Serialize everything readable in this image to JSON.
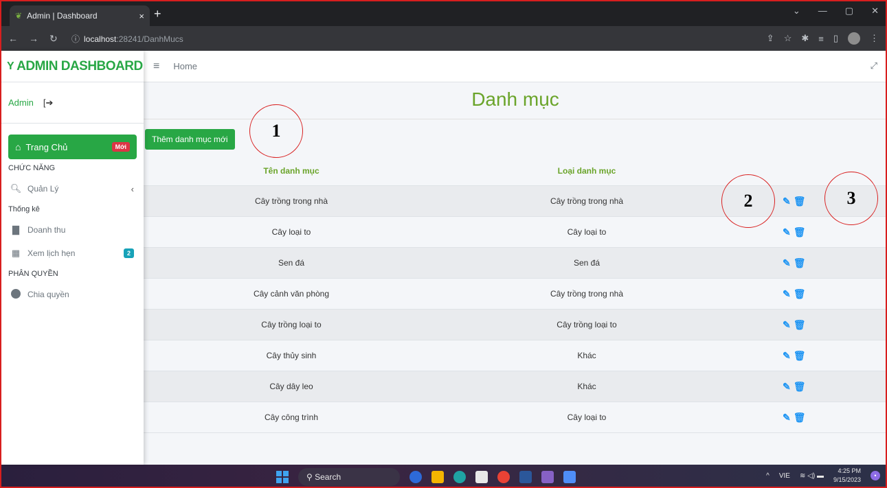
{
  "browser": {
    "tab_title": "Admin | Dashboard",
    "tab_close": "×",
    "new_tab": "+",
    "url_host": "localhost",
    "url_path": ":28241/DanhMucs"
  },
  "sidebar": {
    "brand": "ADMIN DASHBOARD",
    "user_name": "Admin",
    "home": {
      "label": "Trang Chủ",
      "badge": "Mới"
    },
    "sections": [
      {
        "title": "CHỨC NĂNG"
      },
      {
        "title": "Thống kê"
      },
      {
        "title": "PHÂN QUYỀN"
      }
    ],
    "items": [
      {
        "label": "Quản Lý"
      },
      {
        "label": "Doanh thu"
      },
      {
        "label": "Xem lịch hẹn",
        "badge": "2"
      },
      {
        "label": "Chia quyền"
      }
    ]
  },
  "topnav": {
    "breadcrumb": "Home"
  },
  "main": {
    "title": "Danh mục",
    "add_button": "Thêm danh mục mới",
    "columns": [
      "Tên danh mục",
      "Loại danh mục",
      ""
    ],
    "rows": [
      {
        "name": "Cây trồng trong nhà",
        "type": "Cây trồng trong nhà"
      },
      {
        "name": "Cây loại to",
        "type": "Cây loại to"
      },
      {
        "name": "Sen đá",
        "type": "Sen đá"
      },
      {
        "name": "Cây cảnh văn phòng",
        "type": "Cây trồng trong nhà"
      },
      {
        "name": "Cây trồng loại to",
        "type": "Cây trồng loại to"
      },
      {
        "name": "Cây thủy sinh",
        "type": "Khác"
      },
      {
        "name": "Cây dây leo",
        "type": "Khác"
      },
      {
        "name": "Cây công trình",
        "type": "Cây loại to"
      }
    ]
  },
  "annotations": [
    "1",
    "2",
    "3"
  ],
  "taskbar": {
    "search": "Search",
    "lang": "VIE",
    "time": "4:25 PM",
    "date": "9/15/2023"
  },
  "colors": {
    "accent": "#28a745",
    "title_green": "#6aa42a",
    "icon_blue": "#2196f3",
    "annotation_red": "#d81e1e"
  }
}
